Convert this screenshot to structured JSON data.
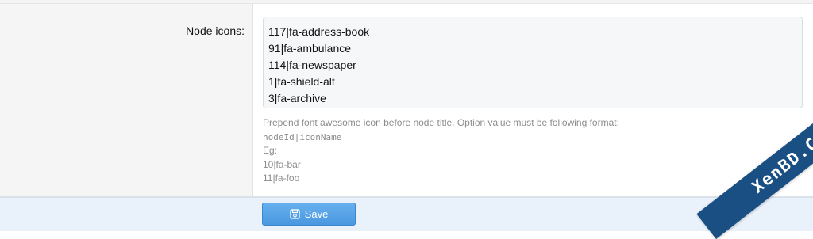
{
  "field": {
    "label": "Node icons:",
    "lines": [
      "117|fa-address-book",
      "91|fa-ambulance",
      "114|fa-newspaper",
      "1|fa-shield-alt",
      "3|fa-archive"
    ]
  },
  "explain": {
    "intro": "Prepend font awesome icon before node title. Option value must be following format:",
    "format": "nodeId|iconName",
    "eg": "Eg:",
    "example1": "10|fa-bar",
    "example2": "11|fa-foo"
  },
  "submit": {
    "save_label": "Save",
    "icon": "save-icon"
  },
  "watermark": {
    "text": "XenBD.Com"
  },
  "colors": {
    "button": "#4a98e0",
    "ribbon": "#1a4f83",
    "submit_bar": "#e9f1fa"
  }
}
